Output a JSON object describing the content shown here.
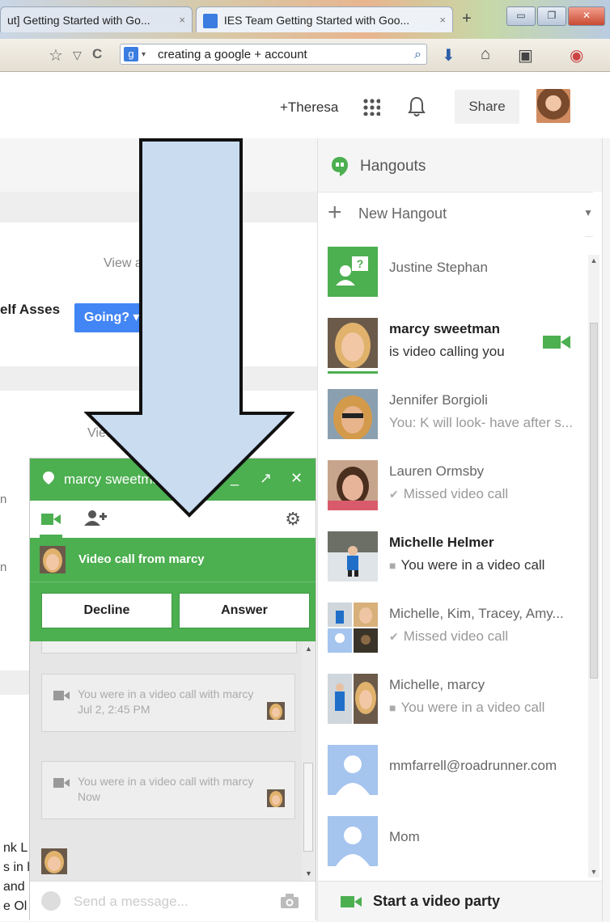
{
  "browser": {
    "tabs": [
      {
        "title": "ut] Getting Started with Go...",
        "close": "×"
      },
      {
        "title": "IES Team Getting Started with Goo...",
        "close": "×"
      }
    ],
    "new_tab": "+",
    "window_controls": {
      "minimize": "▭",
      "restore": "❐",
      "close": "✕"
    },
    "toolbar": {
      "star": "☆",
      "dropdown": "▽",
      "refresh": "C",
      "url": "creating a google + account",
      "search_engine": "g"
    }
  },
  "gbar": {
    "user_link": "+Theresa",
    "share": "Share"
  },
  "background_page": {
    "view_all": "View a",
    "event_title": "elf Asses",
    "going_button": "Going? ▾",
    "view_more": "View more",
    "side_fragments": [
      "n",
      "n"
    ],
    "bottom_fragments": [
      "nk L",
      "s in l",
      "and",
      "e Ol"
    ]
  },
  "hangouts": {
    "title": "Hangouts",
    "new_hangout": "New Hangout",
    "contacts": [
      {
        "name": "Justine Stephan",
        "status": ""
      },
      {
        "name": "marcy sweetman",
        "status": "is video calling you"
      },
      {
        "name": "Jennifer Borgioli",
        "status": "You: K will look- have after s..."
      },
      {
        "name": "Lauren Ormsby",
        "status": "Missed video call"
      },
      {
        "name": "Michelle Helmer",
        "status": "You were in a video call"
      },
      {
        "name": "Michelle, Kim, Tracey, Amy...",
        "status": "Missed video call"
      },
      {
        "name": "Michelle, marcy",
        "status": "You were in a video call"
      },
      {
        "name": "mmfarrell@roadrunner.com",
        "status": ""
      },
      {
        "name": "Mom",
        "status": ""
      }
    ],
    "footer": "Start a video party"
  },
  "chat": {
    "title": "marcy sweetman",
    "controls": {
      "minimize": "_",
      "popout": "↗",
      "close": "✕"
    },
    "incoming": "Video call from marcy",
    "decline": "Decline",
    "answer": "Answer",
    "messages": [
      {
        "text": "You were in a video call with marcy",
        "time": "Jul 2, 2:45 PM"
      },
      {
        "text": "You were in a video call with marcy",
        "time": "Now"
      }
    ],
    "input_placeholder": "Send a message...",
    "gear": "⚙"
  },
  "colors": {
    "hangouts_green": "#4caf50",
    "google_blue": "#4285f4",
    "arrow_fill": "#c9dcf0"
  }
}
